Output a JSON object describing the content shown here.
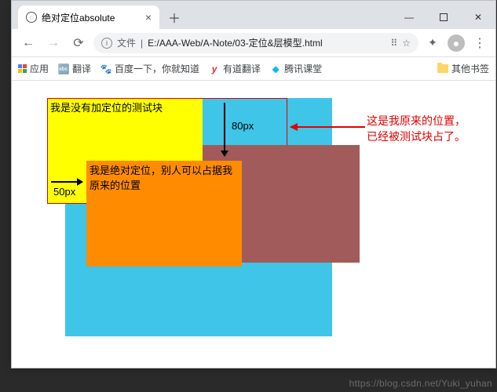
{
  "window": {
    "tab_title": "绝对定位absolute",
    "close_glyph": "×",
    "newtab_glyph": "＋",
    "min_glyph": "—",
    "close_win_glyph": "✕"
  },
  "addr": {
    "back_glyph": "←",
    "fwd_glyph": "→",
    "reload_glyph": "⟳",
    "info_glyph": "i",
    "file_label": "文件",
    "url": "E:/AAA-Web/A-Note/03-定位&层模型.html",
    "translate_glyph": "⠿",
    "star_glyph": "☆",
    "ext_glyph": "✦",
    "menu_glyph": "⋮"
  },
  "bookmarks": {
    "apps": "应用",
    "b1": "翻译",
    "b2": "百度一下，你就知道",
    "b3_icon": "y",
    "b3": "有道翻译",
    "b4": "腾讯课堂",
    "other": "其他书签"
  },
  "content": {
    "yellow_text": "我是没有加定位的测试块",
    "orange_text": "我是绝对定位，别人可以占据我原来的位置",
    "label_80": "80px",
    "label_50": "50px",
    "annotation_line1": "这是我原来的位置，",
    "annotation_line2": "已经被测试块占了。"
  },
  "watermark": "https://blog.csdn.net/Yuki_yuhan"
}
